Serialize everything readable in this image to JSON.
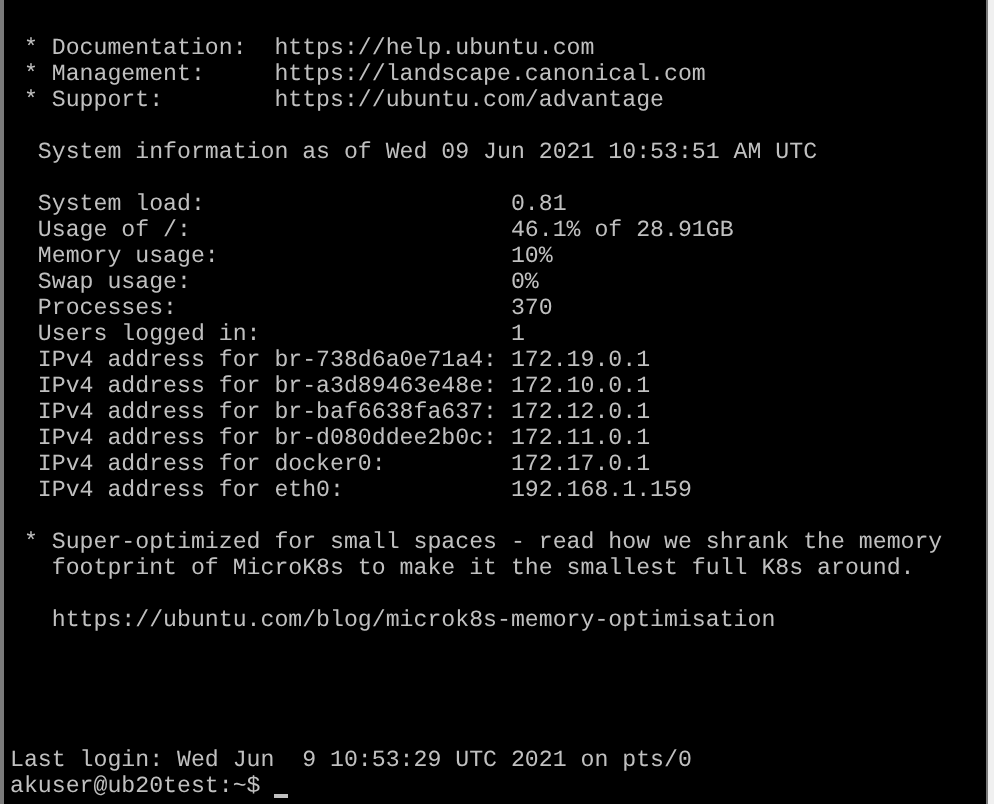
{
  "terminal": {
    "blocks": [
      [
        " * Documentation:  https://help.ubuntu.com",
        " * Management:     https://landscape.canonical.com",
        " * Support:        https://ubuntu.com/advantage"
      ],
      [
        "  System information as of Wed 09 Jun 2021 10:53:51 AM UTC"
      ],
      [
        "  System load:                      0.81",
        "  Usage of /:                       46.1% of 28.91GB",
        "  Memory usage:                     10%",
        "  Swap usage:                       0%",
        "  Processes:                        370",
        "  Users logged in:                  1",
        "  IPv4 address for br-738d6a0e71a4: 172.19.0.1",
        "  IPv4 address for br-a3d89463e48e: 172.10.0.1",
        "  IPv4 address for br-baf6638fa637: 172.12.0.1",
        "  IPv4 address for br-d080ddee2b0c: 172.11.0.1",
        "  IPv4 address for docker0:         172.17.0.1",
        "  IPv4 address for eth0:            192.168.1.159"
      ],
      [
        " * Super-optimized for small spaces - read how we shrank the memory",
        "   footprint of MicroK8s to make it the smallest full K8s around."
      ],
      [
        "   https://ubuntu.com/blog/microk8s-memory-optimisation"
      ]
    ],
    "last_login": "Last login: Wed Jun  9 10:53:29 UTC 2021 on pts/0",
    "prompt": "akuser@ub20test:~$"
  }
}
